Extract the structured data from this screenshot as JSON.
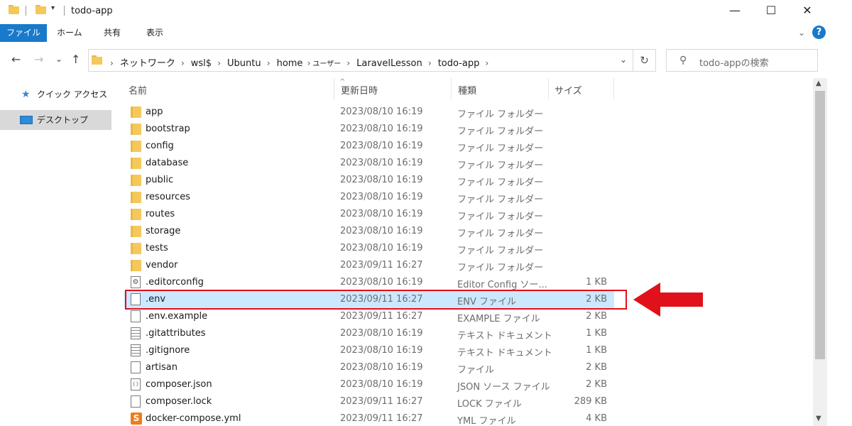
{
  "window": {
    "title": "todo-app",
    "minimize": "—",
    "maximize": "☐",
    "close": "✕",
    "qa_dropdown": "▾"
  },
  "ribbon": {
    "tabs": [
      "ファイル",
      "ホーム",
      "共有",
      "表示"
    ],
    "expand": "⌄",
    "help": "?"
  },
  "nav": {
    "back": "←",
    "forward": "→",
    "recent": "⌄",
    "up": "↑",
    "breadcrumb": [
      "ネットワーク",
      "wsl$",
      "Ubuntu",
      "home",
      "ユーザー",
      "LaravelLesson",
      "todo-app"
    ],
    "address_dropdown": "⌄",
    "refresh": "↻",
    "search_icon": "⚲",
    "search_placeholder": "todo-appの検索"
  },
  "sidebar": {
    "items": [
      {
        "label": "クイック アクセス",
        "icon": "star-icon"
      },
      {
        "label": "デスクトップ",
        "icon": "desktop-icon",
        "selected": true
      }
    ]
  },
  "columns": {
    "sort_indicator": "^",
    "name": "名前",
    "date": "更新日時",
    "type": "種類",
    "size": "サイズ"
  },
  "files": [
    {
      "name": "app",
      "date": "2023/08/10 16:19",
      "type": "ファイル フォルダー",
      "size": "",
      "icon": "folder"
    },
    {
      "name": "bootstrap",
      "date": "2023/08/10 16:19",
      "type": "ファイル フォルダー",
      "size": "",
      "icon": "folder"
    },
    {
      "name": "config",
      "date": "2023/08/10 16:19",
      "type": "ファイル フォルダー",
      "size": "",
      "icon": "folder"
    },
    {
      "name": "database",
      "date": "2023/08/10 16:19",
      "type": "ファイル フォルダー",
      "size": "",
      "icon": "folder"
    },
    {
      "name": "public",
      "date": "2023/08/10 16:19",
      "type": "ファイル フォルダー",
      "size": "",
      "icon": "folder"
    },
    {
      "name": "resources",
      "date": "2023/08/10 16:19",
      "type": "ファイル フォルダー",
      "size": "",
      "icon": "folder"
    },
    {
      "name": "routes",
      "date": "2023/08/10 16:19",
      "type": "ファイル フォルダー",
      "size": "",
      "icon": "folder"
    },
    {
      "name": "storage",
      "date": "2023/08/10 16:19",
      "type": "ファイル フォルダー",
      "size": "",
      "icon": "folder"
    },
    {
      "name": "tests",
      "date": "2023/08/10 16:19",
      "type": "ファイル フォルダー",
      "size": "",
      "icon": "folder"
    },
    {
      "name": "vendor",
      "date": "2023/09/11 16:27",
      "type": "ファイル フォルダー",
      "size": "",
      "icon": "folder"
    },
    {
      "name": ".editorconfig",
      "date": "2023/08/10 16:19",
      "type": "Editor Config ソー...",
      "size": "1 KB",
      "icon": "gear"
    },
    {
      "name": ".env",
      "date": "2023/09/11 16:27",
      "type": "ENV ファイル",
      "size": "2 KB",
      "icon": "file",
      "selected": true
    },
    {
      "name": ".env.example",
      "date": "2023/09/11 16:27",
      "type": "EXAMPLE ファイル",
      "size": "2 KB",
      "icon": "file"
    },
    {
      "name": ".gitattributes",
      "date": "2023/08/10 16:19",
      "type": "テキスト ドキュメント",
      "size": "1 KB",
      "icon": "text"
    },
    {
      "name": ".gitignore",
      "date": "2023/08/10 16:19",
      "type": "テキスト ドキュメント",
      "size": "1 KB",
      "icon": "text"
    },
    {
      "name": "artisan",
      "date": "2023/08/10 16:19",
      "type": "ファイル",
      "size": "2 KB",
      "icon": "file"
    },
    {
      "name": "composer.json",
      "date": "2023/08/10 16:19",
      "type": "JSON ソース ファイル",
      "size": "2 KB",
      "icon": "json"
    },
    {
      "name": "composer.lock",
      "date": "2023/09/11 16:27",
      "type": "LOCK ファイル",
      "size": "289 KB",
      "icon": "file"
    },
    {
      "name": "docker-compose.yml",
      "date": "2023/09/11 16:27",
      "type": "YML ファイル",
      "size": "4 KB",
      "icon": "sublime"
    }
  ],
  "scroll": {
    "up": "▲",
    "down": "▼"
  },
  "colors": {
    "accent": "#1979ca",
    "selection": "#cce8ff",
    "highlight": "#e0111a",
    "folder": "#f5c85a"
  }
}
